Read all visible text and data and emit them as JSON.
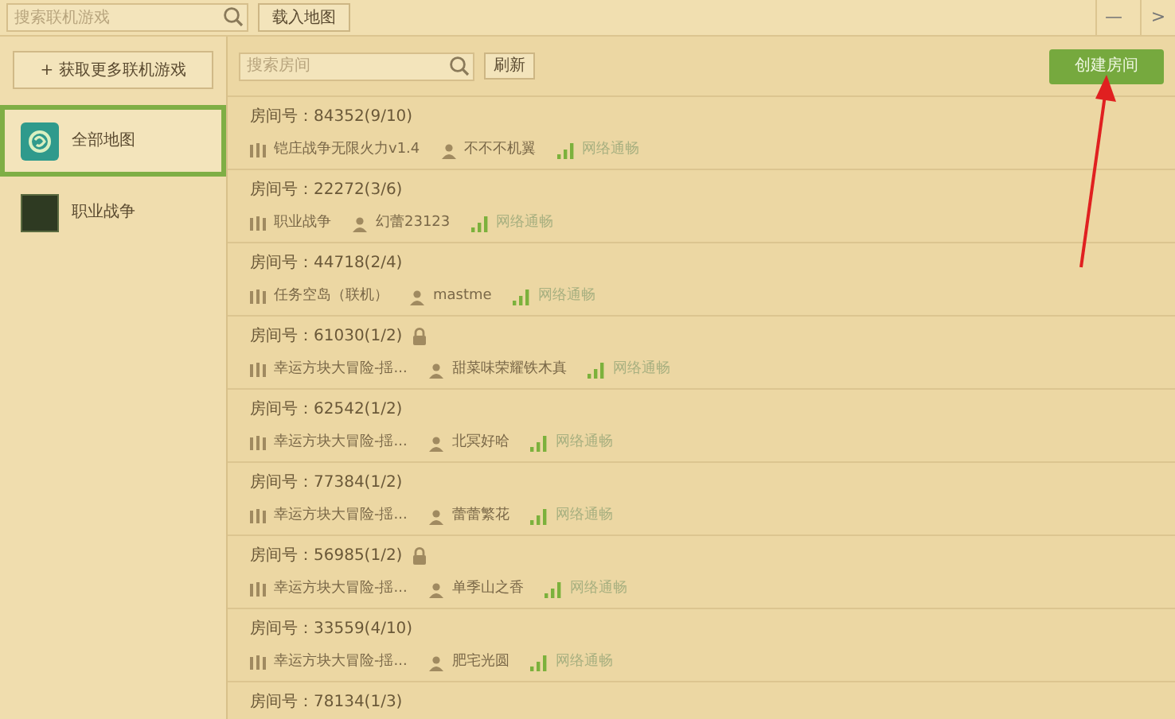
{
  "top_bar": {
    "search_placeholder": "搜索联机游戏",
    "load_map_button": "载入地图",
    "window_controls": [
      "—",
      ">"
    ]
  },
  "sidebar": {
    "more_games_button": "+ 获取更多联机游戏",
    "items": [
      {
        "label": "全部地图",
        "kind": "all",
        "selected": true
      },
      {
        "label": "职业战争",
        "kind": "game",
        "selected": false
      }
    ]
  },
  "room_toolbar": {
    "search_placeholder": "搜索房间",
    "refresh_button": "刷新",
    "create_button": "创建房间"
  },
  "rooms": [
    {
      "title": "房间号：84352(9/10)",
      "locked": false,
      "map": "铠庄战争无限火力v1.4",
      "owner": "不不不机翼",
      "network": "网络通畅"
    },
    {
      "title": "房间号：22272(3/6)",
      "locked": false,
      "map": "职业战争",
      "owner": "幻蕾23123",
      "network": "网络通畅"
    },
    {
      "title": "房间号：44718(2/4)",
      "locked": false,
      "map": "任务空岛（联机）",
      "owner": "mastme",
      "network": "网络通畅"
    },
    {
      "title": "房间号：61030(1/2)",
      "locked": true,
      "map": "幸运方块大冒险-揺...",
      "owner": "甜菜味荣耀铁木真",
      "network": "网络通畅"
    },
    {
      "title": "房间号：62542(1/2)",
      "locked": false,
      "map": "幸运方块大冒险-揺...",
      "owner": "北冥好哈",
      "network": "网络通畅"
    },
    {
      "title": "房间号：77384(1/2)",
      "locked": false,
      "map": "幸运方块大冒险-揺...",
      "owner": "蕾蕾繁花",
      "network": "网络通畅"
    },
    {
      "title": "房间号：56985(1/2)",
      "locked": true,
      "map": "幸运方块大冒险-揺...",
      "owner": "单季山之香",
      "network": "网络通畅"
    },
    {
      "title": "房间号：33559(4/10)",
      "locked": false,
      "map": "幸运方块大冒险-揺...",
      "owner": "肥宅光圆",
      "network": "网络通畅"
    },
    {
      "title": "房间号：78134(1/3)",
      "locked": false
    }
  ]
}
